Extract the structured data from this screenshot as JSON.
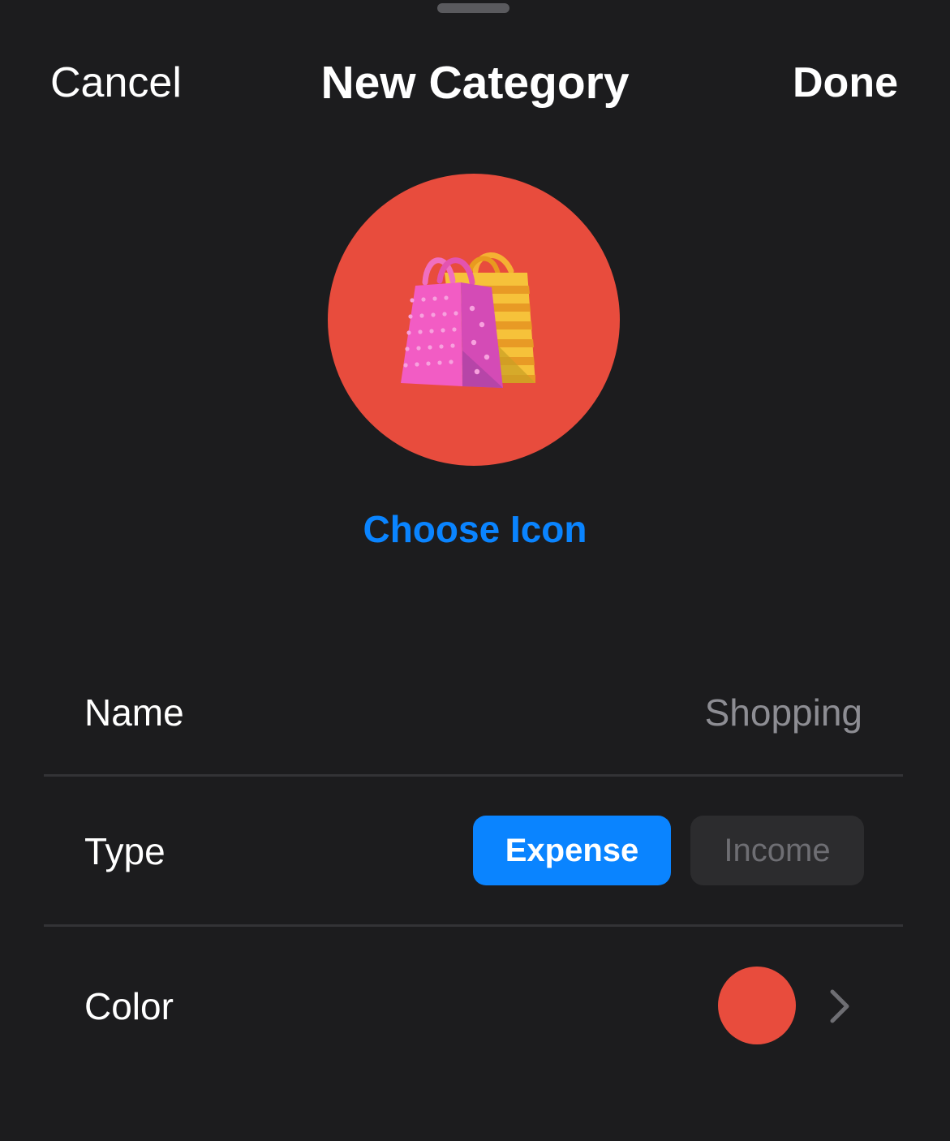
{
  "nav": {
    "cancel_label": "Cancel",
    "title": "New Category",
    "done_label": "Done"
  },
  "icon": {
    "emoji": "shopping-bags-icon",
    "background_color": "#e84c3d",
    "choose_label": "Choose Icon"
  },
  "form": {
    "name": {
      "label": "Name",
      "value": "Shopping"
    },
    "type": {
      "label": "Type",
      "options": [
        "Expense",
        "Income"
      ],
      "selected": "Expense"
    },
    "color": {
      "label": "Color",
      "value": "#e84c3d",
      "chevron_icon": "chevron-right-icon"
    }
  },
  "colors": {
    "accent": "#0a84ff",
    "background": "#1c1c1e"
  }
}
